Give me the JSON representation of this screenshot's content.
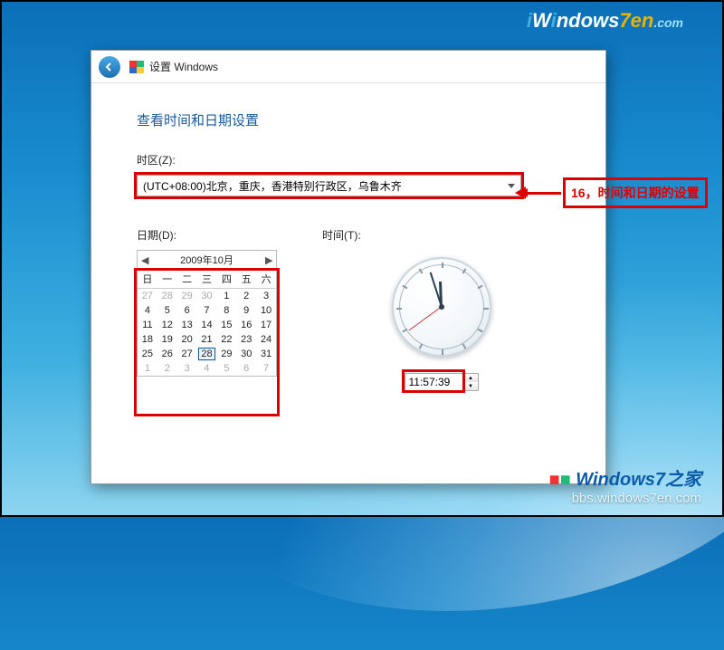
{
  "branding": {
    "top_text": "iWindows7en.com",
    "bottom_brand": "Windows7之家",
    "bottom_url": "bbs.windows7en.com"
  },
  "titlebar": {
    "title": "设置 Windows"
  },
  "page": {
    "heading": "查看时间和日期设置",
    "tz_label": "时区(Z):",
    "tz_value": "(UTC+08:00)北京，重庆，香港特别行政区，乌鲁木齐",
    "date_label": "日期(D):",
    "time_label": "时间(T):"
  },
  "annotation": {
    "text": "16，时间和日期的设置"
  },
  "calendar": {
    "month_title": "2009年10月",
    "prev": "◀",
    "next": "▶",
    "dow": [
      "日",
      "一",
      "二",
      "三",
      "四",
      "五",
      "六"
    ],
    "days": [
      {
        "n": "27",
        "muted": true
      },
      {
        "n": "28",
        "muted": true
      },
      {
        "n": "29",
        "muted": true
      },
      {
        "n": "30",
        "muted": true
      },
      {
        "n": "1"
      },
      {
        "n": "2"
      },
      {
        "n": "3"
      },
      {
        "n": "4"
      },
      {
        "n": "5"
      },
      {
        "n": "6"
      },
      {
        "n": "7"
      },
      {
        "n": "8"
      },
      {
        "n": "9"
      },
      {
        "n": "10"
      },
      {
        "n": "11"
      },
      {
        "n": "12"
      },
      {
        "n": "13"
      },
      {
        "n": "14"
      },
      {
        "n": "15"
      },
      {
        "n": "16"
      },
      {
        "n": "17"
      },
      {
        "n": "18"
      },
      {
        "n": "19"
      },
      {
        "n": "20"
      },
      {
        "n": "21"
      },
      {
        "n": "22"
      },
      {
        "n": "23"
      },
      {
        "n": "24"
      },
      {
        "n": "25"
      },
      {
        "n": "26"
      },
      {
        "n": "27"
      },
      {
        "n": "28",
        "selected": true
      },
      {
        "n": "29"
      },
      {
        "n": "30"
      },
      {
        "n": "31"
      },
      {
        "n": "1",
        "muted": true
      },
      {
        "n": "2",
        "muted": true
      },
      {
        "n": "3",
        "muted": true
      },
      {
        "n": "4",
        "muted": true
      },
      {
        "n": "5",
        "muted": true
      },
      {
        "n": "6",
        "muted": true
      },
      {
        "n": "7",
        "muted": true
      }
    ]
  },
  "time": {
    "value": "11:57:39"
  }
}
